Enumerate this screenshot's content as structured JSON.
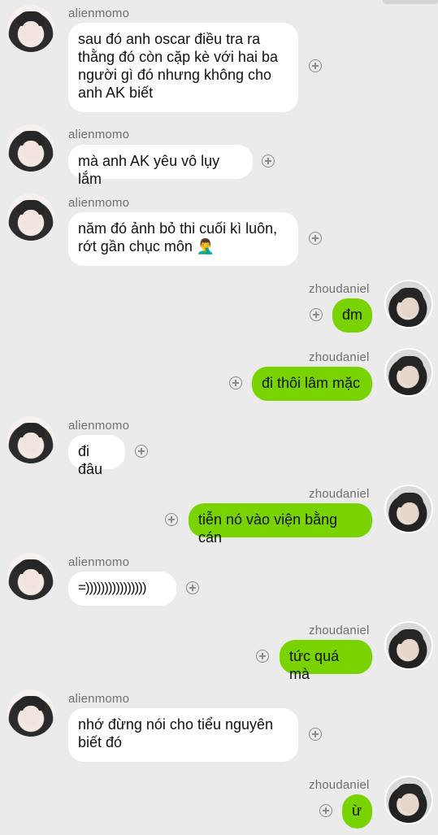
{
  "users": {
    "left": "alienmomo",
    "right": "zhoudaniel"
  },
  "messages": [
    {
      "sender": "alienmomo",
      "text": "sau đó anh oscar điều tra ra\nthằng đó còn cặp kè với hai ba\nngười gì đó nhưng không cho\nanh AK biết"
    },
    {
      "sender": "alienmomo",
      "text": "mà anh AK yêu vô lụy lắm"
    },
    {
      "sender": "alienmomo",
      "text": "năm đó ảnh bỏ thi cuối kì luôn,\nrớt gần chục môn 🤦‍♂️"
    },
    {
      "sender": "zhoudaniel",
      "text": "đm"
    },
    {
      "sender": "zhoudaniel",
      "text": "đi thôi lâm mặc"
    },
    {
      "sender": "alienmomo",
      "text": "đi đâu"
    },
    {
      "sender": "zhoudaniel",
      "text": "tiễn nó vào viện bằng cán"
    },
    {
      "sender": "alienmomo",
      "text": "=))))))))))))))))"
    },
    {
      "sender": "zhoudaniel",
      "text": "tức quá mà"
    },
    {
      "sender": "alienmomo",
      "text": "nhớ đừng nói cho tiểu nguyên\nbiết đó"
    },
    {
      "sender": "zhoudaniel",
      "text": "ừ"
    }
  ],
  "icons": {
    "avatar_left": "avatar-alienmomo",
    "avatar_right": "avatar-zhoudaniel",
    "action": "plus-circle-icon"
  },
  "colors": {
    "background": "#ebebeb",
    "incoming_bubble": "#ffffff",
    "outgoing_bubble": "#78d300",
    "name_text": "#6f6f6f"
  }
}
